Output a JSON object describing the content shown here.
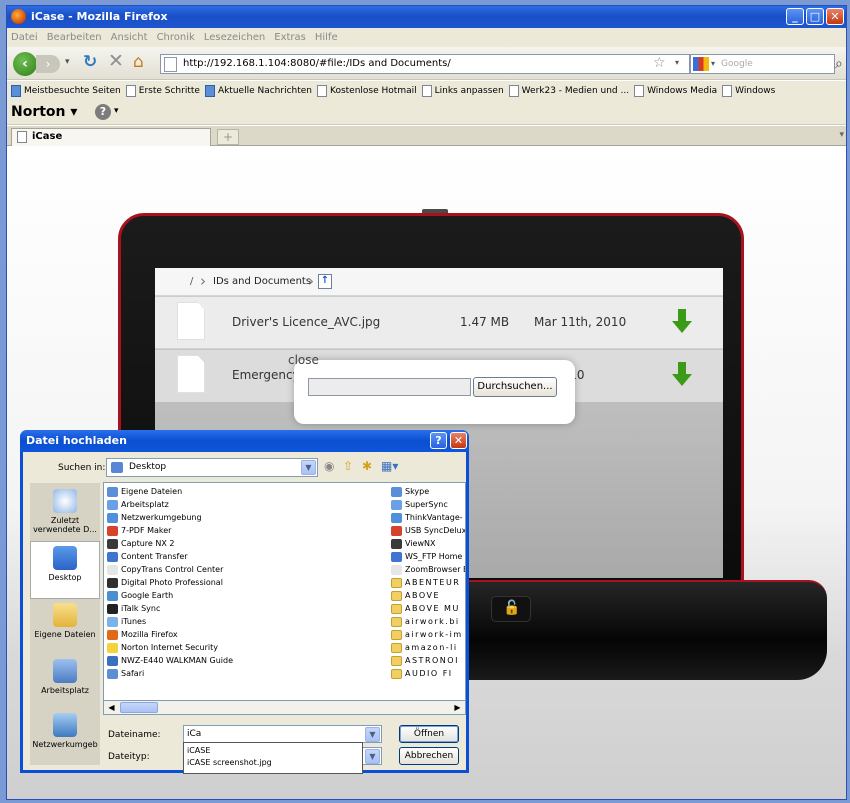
{
  "window": {
    "title": "iCase - Mozilla Firefox"
  },
  "menu": [
    "Datei",
    "Bearbeiten",
    "Ansicht",
    "Chronik",
    "Lesezeichen",
    "Extras",
    "Hilfe"
  ],
  "navbar": {
    "url": "http://192.168.1.104:8080/#file:/IDs and Documents/",
    "search_placeholder": "Google"
  },
  "bookmarks": [
    "Meistbesuchte Seiten",
    "Erste Schritte",
    "Aktuelle Nachrichten",
    "Kostenlose Hotmail",
    "Links anpassen",
    "Werk23 - Medien und ...",
    "Windows Media",
    "Windows"
  ],
  "norton": {
    "label": "Norton",
    "dd": "▾"
  },
  "tab": {
    "label": "iCase",
    "new_tab": "+"
  },
  "page": {
    "breadcrumb": {
      "root": "/",
      "folder": "IDs and Documents"
    },
    "files": [
      {
        "name": "Driver's Licence_AVC.jpg",
        "size": "1.47 MB",
        "date": "Mar 11th, 2010"
      },
      {
        "name": "Emergency_",
        "size": "",
        "date": "th, 2010"
      }
    ],
    "upload": {
      "close_label": "close",
      "browse_label": "Durchsuchen..."
    }
  },
  "dialog": {
    "title": "Datei hochladen",
    "lookin_label": "Suchen in:",
    "lookin_value": "Desktop",
    "places": [
      "Zuletzt verwendete D...",
      "Desktop",
      "Eigene Dateien",
      "Arbeitsplatz",
      "Netzwerkumgeb"
    ],
    "col1": [
      "Eigene Dateien",
      "Arbeitsplatz",
      "Netzwerkumgebung",
      "7-PDF Maker",
      "Capture NX 2",
      "Content Transfer",
      "CopyTrans Control Center",
      "Digital Photo Professional",
      "Google Earth",
      "iTalk Sync",
      "iTunes",
      "Mozilla Firefox",
      "Norton Internet Security",
      "NWZ-E440 WALKMAN Guide",
      "Safari"
    ],
    "col2": [
      "Skype",
      "SuperSync",
      "ThinkVantage-",
      "USB SyncDelux",
      "ViewNX",
      "WS_FTP Home",
      "ZoomBrowser E",
      "ABENTEUR",
      "ABOVE",
      "ABOVE MU",
      "airwork.bi",
      "airwork-im",
      "amazon-li",
      "ASTRONOI",
      "AUDIO FI"
    ],
    "filename_label": "Dateiname:",
    "filename_value": "iCa",
    "filetype_label": "Dateityp:",
    "autocomplete": [
      "iCASE",
      "iCASE screenshot.jpg"
    ],
    "open_label": "Öffnen",
    "cancel_label": "Abbrechen"
  },
  "colors": {
    "accent_red": "#a8121e",
    "download_green": "#3b9a16",
    "xp_blue": "#0a4fd6"
  }
}
